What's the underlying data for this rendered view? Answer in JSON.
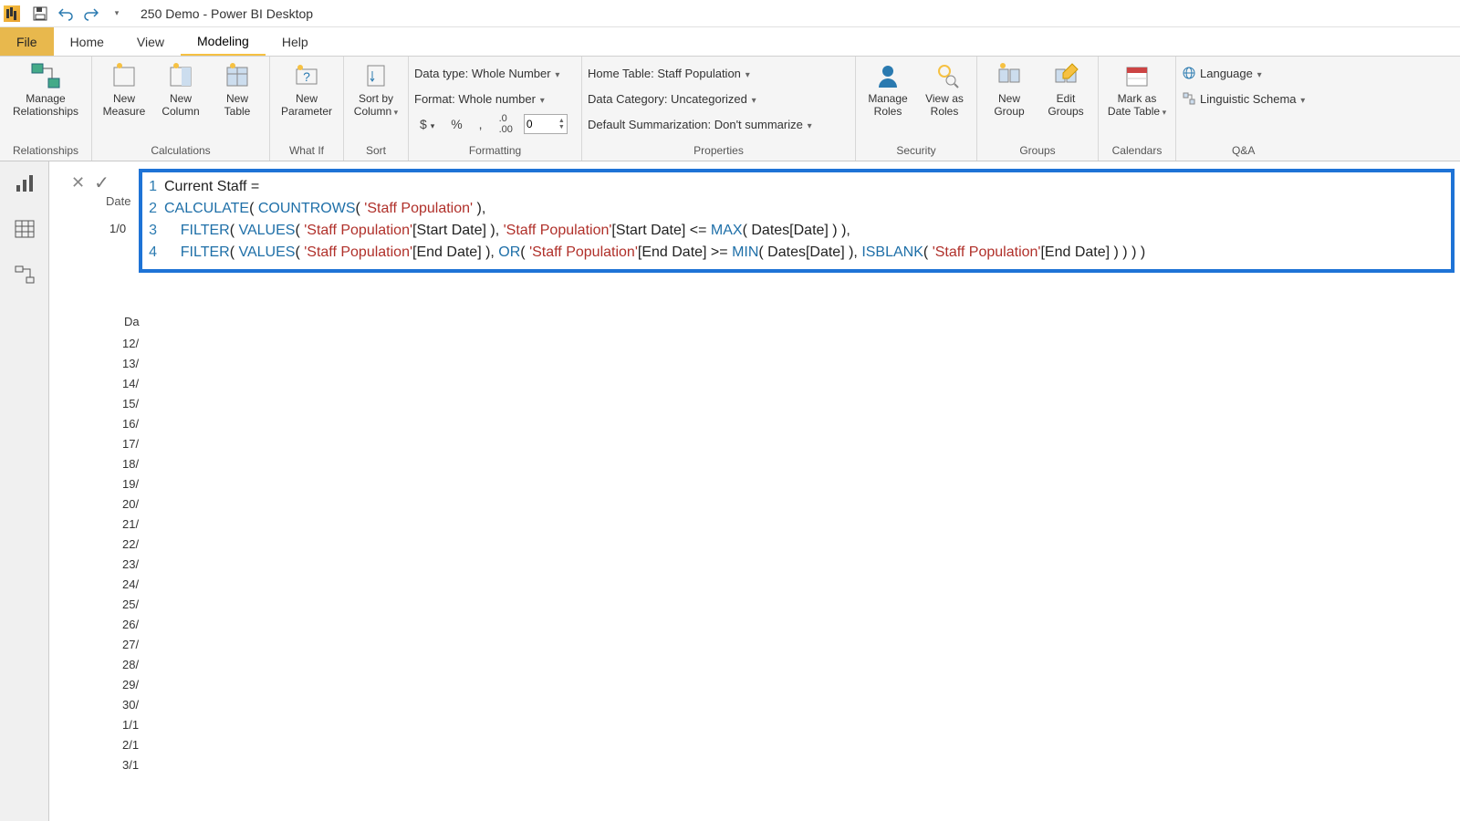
{
  "title": "250 Demo - Power BI Desktop",
  "qat": {
    "save": "save",
    "undo": "undo",
    "redo": "redo"
  },
  "tabs": {
    "file": "File",
    "home": "Home",
    "view": "View",
    "modeling": "Modeling",
    "help": "Help"
  },
  "ribbon": {
    "relationships": {
      "label": "Relationships",
      "manage": "Manage\nRelationships"
    },
    "calculations": {
      "label": "Calculations",
      "newMeasure": "New\nMeasure",
      "newColumn": "New\nColumn",
      "newTable": "New\nTable"
    },
    "whatif": {
      "label": "What If",
      "newParameter": "New\nParameter"
    },
    "sort": {
      "label": "Sort",
      "sortBy": "Sort by\nColumn"
    },
    "formatting": {
      "label": "Formatting",
      "dataType": "Data type: Whole Number",
      "format": "Format: Whole number",
      "decimals": "0"
    },
    "properties": {
      "label": "Properties",
      "homeTable": "Home Table: Staff Population",
      "dataCategory": "Data Category: Uncategorized",
      "defaultSum": "Default Summarization: Don't summarize"
    },
    "security": {
      "label": "Security",
      "manageRoles": "Manage\nRoles",
      "viewAs": "View as\nRoles"
    },
    "groups": {
      "label": "Groups",
      "newGroup": "New\nGroup",
      "editGroups": "Edit\nGroups"
    },
    "calendars": {
      "label": "Calendars",
      "markAs": "Mark as\nDate Table"
    },
    "qa": {
      "label": "Q&A",
      "language": "Language",
      "schema": "Linguistic Schema"
    }
  },
  "formula": {
    "line1": "Current Staff =",
    "line2_a": "CALCULATE",
    "line2_b": "( ",
    "line2_c": "COUNTROWS",
    "line2_d": "( ",
    "line2_e": "'Staff Population'",
    "line2_f": " ),",
    "line3_indent": "    ",
    "line3_a": "FILTER",
    "line3_b": "( ",
    "line3_c": "VALUES",
    "line3_d": "( ",
    "line3_e": "'Staff Population'",
    "line3_f": "[Start Date] ), ",
    "line3_g": "'Staff Population'",
    "line3_h": "[Start Date] <= ",
    "line3_i": "MAX",
    "line3_j": "( Dates[Date] ) ),",
    "line4_indent": "    ",
    "line4_a": "FILTER",
    "line4_b": "( ",
    "line4_c": "VALUES",
    "line4_d": "( ",
    "line4_e": "'Staff Population'",
    "line4_f": "[End Date] ), ",
    "line4_g": "OR",
    "line4_h": "( ",
    "line4_i": "'Staff Population'",
    "line4_j": "[End Date] >= ",
    "line4_k": "MIN",
    "line4_l": "( Dates[Date] ), ",
    "line4_m": "ISBLANK",
    "line4_n": "( ",
    "line4_o": "'Staff Population'",
    "line4_p": "[End Date] ) ) ) )"
  },
  "peek": {
    "header1": "Date",
    "cell1": "1/0",
    "header2": "Da",
    "rows": [
      "12/",
      "13/",
      "14/",
      "15/",
      "16/",
      "17/",
      "18/",
      "19/",
      "20/",
      "21/",
      "22/",
      "23/",
      "24/",
      "25/",
      "26/",
      "27/",
      "28/",
      "29/",
      "30/",
      "1/1",
      "2/1",
      "3/1"
    ]
  }
}
